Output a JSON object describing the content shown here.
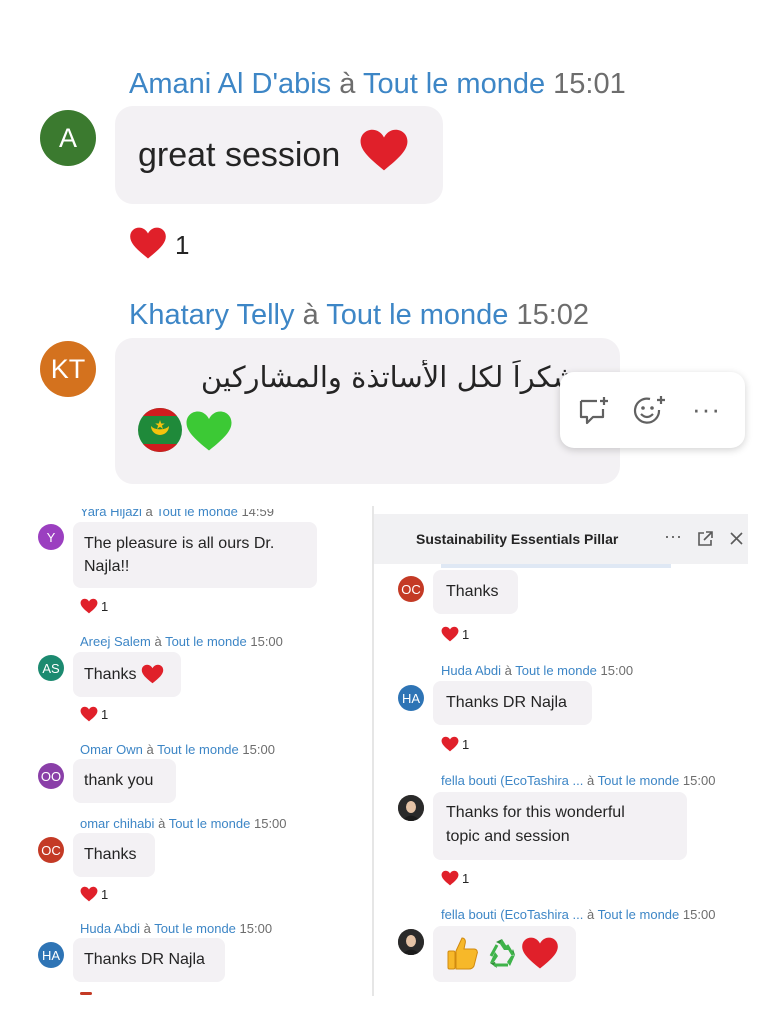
{
  "top": {
    "messages": [
      {
        "author": "Amani Al D'abis",
        "sep": "à",
        "target": "Tout le monde",
        "time": "15:01",
        "initials": "A",
        "text": "great session",
        "reaction_count": "1",
        "avatar_color": "#3b7a2f"
      },
      {
        "author": "Khatary Telly",
        "sep": "à",
        "target": "Tout le monde",
        "time": "15:02",
        "initials": "KT",
        "text": "شكراً لكل الأساتذة والمشاركين",
        "avatar_color": "#d4721e"
      }
    ],
    "hover_actions": [
      "reply-icon",
      "add-reaction-icon",
      "more-options-icon"
    ]
  },
  "left": {
    "messages": [
      {
        "author": "Yara Hijazi",
        "sep": "à",
        "target": "Tout le monde",
        "time": "14:59",
        "initials": "Y",
        "line1": "The pleasure is all ours Dr.",
        "line2": "Najla!!",
        "reaction_count": "1",
        "avatar_color": "#9b3fc0"
      },
      {
        "author": "Areej Salem",
        "sep": "à",
        "target": "Tout le monde",
        "time": "15:00",
        "initials": "AS",
        "text": "Thanks",
        "reaction_count": "1",
        "avatar_color": "#1c8a70"
      },
      {
        "author": "Omar Own",
        "sep": "à",
        "target": "Tout le monde",
        "time": "15:00",
        "initials": "OO",
        "text": "thank you",
        "avatar_color": "#8a3fa8"
      },
      {
        "author": "omar chihabi",
        "sep": "à",
        "target": "Tout le monde",
        "time": "15:00",
        "initials": "OC",
        "text": "Thanks",
        "reaction_count": "1",
        "avatar_color": "#c43a25"
      },
      {
        "author": "Huda Abdi",
        "sep": "à",
        "target": "Tout le monde",
        "time": "15:00",
        "initials": "HA",
        "text": "Thanks DR Najla",
        "avatar_color": "#2e74b5"
      }
    ]
  },
  "right": {
    "title": "Sustainability Essentials Pillar",
    "messages": [
      {
        "initials": "OC",
        "text": "Thanks",
        "reaction_count": "1",
        "avatar_color": "#c43a25"
      },
      {
        "author": "Huda Abdi",
        "sep": "à",
        "target": "Tout le monde",
        "time": "15:00",
        "initials": "HA",
        "text": "Thanks DR Najla",
        "reaction_count": "1",
        "avatar_color": "#2e74b5"
      },
      {
        "author": "fella bouti (EcoTashira ...",
        "sep": "à",
        "target": "Tout le monde",
        "time": "15:00",
        "line1": "Thanks for this wonderful",
        "line2": "topic and session",
        "reaction_count": "1"
      },
      {
        "author": "fella bouti (EcoTashira ...",
        "sep": "à",
        "target": "Tout le monde",
        "time": "15:00"
      }
    ]
  }
}
